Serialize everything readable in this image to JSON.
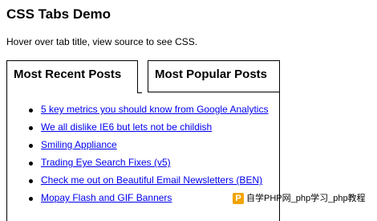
{
  "page": {
    "title": "CSS Tabs Demo",
    "subtitle": "Hover over tab title, view source to see CSS."
  },
  "tabs": [
    {
      "label": "Most Recent Posts",
      "active": true
    },
    {
      "label": "Most Popular Posts",
      "active": false
    }
  ],
  "posts": [
    "5 key metrics you should know from Google Analytics",
    "We all dislike IE6 but lets not be childish",
    "Smiling Appliance",
    "Trading Eye Search Fixes (v5)",
    "Check me out on Beautiful Email Newsletters (BEN)",
    "Mopay Flash and GIF Banners"
  ],
  "watermark": {
    "logo_letter": "P",
    "text": "自学PHP网_php学习_php教程"
  },
  "colors": {
    "link": "#0000ee",
    "watermark_logo": "#f2a400"
  }
}
